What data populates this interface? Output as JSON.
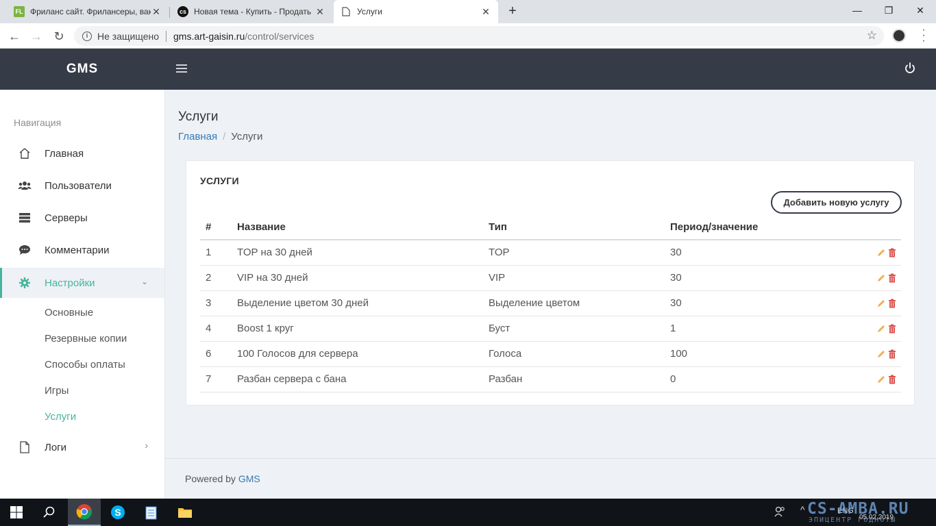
{
  "browser": {
    "tabs": [
      {
        "title": "Фриланс сайт. Фрилансеры, вак",
        "favicon": "FL"
      },
      {
        "title": "Новая тема - Купить - Продать",
        "favicon": "cs"
      },
      {
        "title": "Услуги",
        "favicon": "page-icon"
      }
    ],
    "security_label": "Не защищено",
    "url_host": "gms.art-gaisin.ru",
    "url_path": "/control/services"
  },
  "app": {
    "brand": "GMS"
  },
  "sidebar": {
    "caption": "Навигация",
    "items": [
      {
        "label": "Главная",
        "icon": "home-icon"
      },
      {
        "label": "Пользователи",
        "icon": "users-icon"
      },
      {
        "label": "Серверы",
        "icon": "servers-icon"
      },
      {
        "label": "Комментарии",
        "icon": "comments-icon"
      },
      {
        "label": "Настройки",
        "icon": "gear-icon"
      },
      {
        "label": "Логи",
        "icon": "file-icon"
      }
    ],
    "subitems": [
      "Основные",
      "Резервные копии",
      "Способы оплаты",
      "Игры",
      "Услуги"
    ]
  },
  "page": {
    "title": "Услуги",
    "breadcrumb_home": "Главная",
    "breadcrumb_current": "Услуги"
  },
  "card": {
    "title": "УСЛУГИ",
    "add_button": "Добавить новую услугу",
    "columns": [
      "#",
      "Название",
      "Тип",
      "Период/значение"
    ],
    "rows": [
      {
        "id": "1",
        "name": "TOP на 30 дней",
        "type": "TOP",
        "value": "30"
      },
      {
        "id": "2",
        "name": "VIP на 30 дней",
        "type": "VIP",
        "value": "30"
      },
      {
        "id": "3",
        "name": "Выделение цветом 30 дней",
        "type": "Выделение цветом",
        "value": "30"
      },
      {
        "id": "4",
        "name": "Boost 1 круг",
        "type": "Буст",
        "value": "1"
      },
      {
        "id": "6",
        "name": "100 Голосов для сервера",
        "type": "Голоса",
        "value": "100"
      },
      {
        "id": "7",
        "name": "Разбан сервера с бана",
        "type": "Разбан",
        "value": "0"
      }
    ]
  },
  "footer": {
    "text": "Powered by ",
    "link": "GMS"
  },
  "taskbar": {
    "lang": "ENG",
    "date": "05.02.2019"
  },
  "watermark": {
    "line1": "CS-AMBA.RU",
    "line2": "ЭПИЦЕНТР ГОДНОТЫ"
  },
  "colors": {
    "accent": "#47b39c",
    "header_bg": "#353c48",
    "link": "#337ab7",
    "edit_icon": "#f0ad4e",
    "delete_icon": "#d9534f"
  }
}
